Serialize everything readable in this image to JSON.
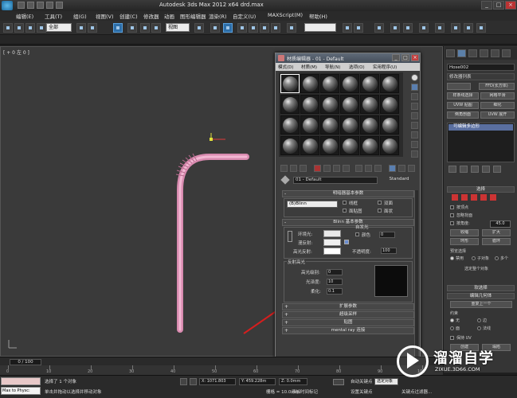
{
  "titlebar": {
    "title": "Autodesk 3ds Max  2012 x64    drd.max",
    "buttons": [
      "_",
      "□",
      "×"
    ]
  },
  "menubar": {
    "items": [
      "编辑(E)",
      "工具(T)",
      "组(G)",
      "视图(V)",
      "创建(C)",
      "修改器",
      "动画",
      "图形编辑器",
      "渲染(R)",
      "自定义(U)",
      "MAXScript(M)",
      "帮助(H)"
    ]
  },
  "toolbar": {
    "selection_filter": "全部",
    "reference_coord": "视图"
  },
  "viewport": {
    "label": "[ + 0 左 0 ]"
  },
  "material_editor": {
    "title": "材质编辑器 - 01 - Default",
    "menu": [
      "模式(D)",
      "材质(M)",
      "导航(N)",
      "选项(O)",
      "实用程序(U)"
    ],
    "material_name": "01 - Default",
    "material_type": "Standard",
    "rollouts": {
      "shader_basic": "明暗器基本参数",
      "shader_type": "(B)Blinn",
      "wire": "线框",
      "two_sided": "双面",
      "face_map": "面贴图",
      "faceted": "面状",
      "blinn_basic": "Blinn 基本参数",
      "self_illum": "自发光",
      "color": "颜色",
      "self_illum_value": "0",
      "ambient": "环境光:",
      "diffuse": "漫反射:",
      "specular": "高光反射:",
      "opacity": "不透明度:",
      "opacity_value": "100",
      "specular_highlights": "反射高光",
      "spec_level": "高光级别:",
      "spec_level_value": "0",
      "glossiness": "光泽度:",
      "glossiness_value": "10",
      "soften": "柔化:",
      "soften_value": "0.1",
      "extended": "扩展参数",
      "supersampling": "超级采样",
      "maps": "贴图",
      "mental_ray": "mental ray 连接"
    },
    "colors": {
      "ambient": "#e8e8e8",
      "diffuse": "#f0f0f0",
      "specular": "#ffffff"
    }
  },
  "command_panel": {
    "object_name": "Hose002",
    "modifier_list": "修改器列表",
    "buttons": [
      "FFD(长方体)",
      "样条线选择",
      "网格平滑",
      "UVW 贴图",
      "细化",
      "倒角剖面",
      "UVW 展开"
    ],
    "stack_item": "可编辑多边形",
    "selection_title": "选择",
    "by_vertex": "按顶点",
    "ignore_backface": "忽略背面",
    "by_angle": "按角度:",
    "by_angle_value": "45.0",
    "shrink": "收缩",
    "grow": "扩大",
    "ring": "环形",
    "loop": "循环",
    "preview_selection": "预览选择",
    "disabled": "禁用",
    "subobject": "子对象",
    "multi": "多个",
    "select_whole": "选定整个对象",
    "soft_selection": "软选择",
    "edit_geometry": "编辑几何体",
    "repeat_last": "重复上一个",
    "constraints": "约束",
    "none": "无",
    "edge": "边",
    "face": "面",
    "normal": "法线",
    "preserve_uv": "保持 UV",
    "create": "创建",
    "collapse": "塌陷"
  },
  "timeline": {
    "frame": "0 / 100",
    "ticks": [
      "0",
      "10",
      "20",
      "30",
      "40",
      "50",
      "60",
      "70",
      "80",
      "90",
      "100"
    ]
  },
  "statusbar": {
    "maxscript": "Max to Physc:",
    "selected": "选择了 1 个对象",
    "prompt": "单击并拖动以选择并移动对象",
    "x_value": "X: 1071.803",
    "y_value": "Y: 459.228m",
    "z_value": "Z: 0.0mm",
    "grid": "栅格 = 10.0mm",
    "add_time_tag": "添加时间标记",
    "auto_key": "自动关键点",
    "set_key": "设置关键点",
    "selected_obj": "选定对象",
    "key_filters": "关键点过滤器..."
  },
  "watermark": {
    "brand": "溜溜自学",
    "url": "ZIXUE.3D66.COM"
  }
}
